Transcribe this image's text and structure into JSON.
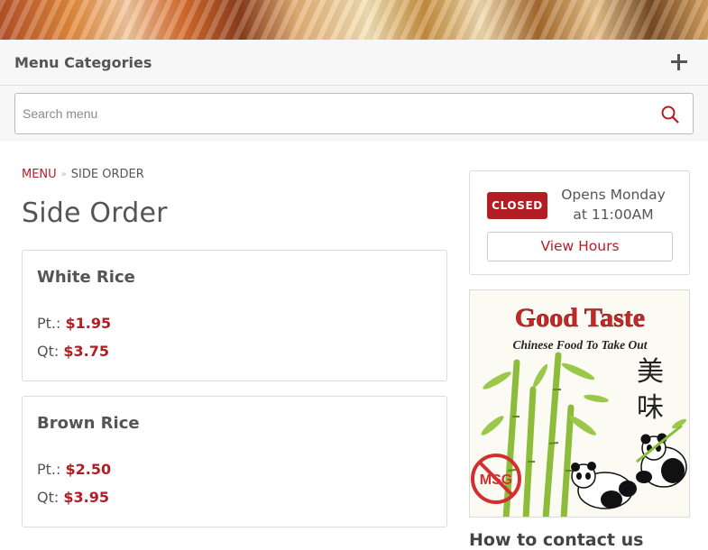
{
  "menu_categories": {
    "title": "Menu Categories",
    "toggle_icon": "plus-icon"
  },
  "search": {
    "placeholder": "Search menu",
    "value": "",
    "icon": "search-icon"
  },
  "breadcrumb": {
    "root": "MENU",
    "current": "SIDE ORDER"
  },
  "page": {
    "title": "Side Order"
  },
  "items": [
    {
      "name": "White Rice",
      "prices": [
        {
          "size": "Pt.:",
          "price": "$1.95"
        },
        {
          "size": "Qt:",
          "price": "$3.75"
        }
      ]
    },
    {
      "name": "Brown Rice",
      "prices": [
        {
          "size": "Pt.:",
          "price": "$2.50"
        },
        {
          "size": "Qt:",
          "price": "$3.95"
        }
      ]
    }
  ],
  "hours": {
    "status": "CLOSED",
    "opens_line1": "Opens Monday",
    "opens_line2": "at 11:00AM",
    "view_hours_label": "View Hours"
  },
  "logo": {
    "name": "Good Taste",
    "tagline": "Chinese Food To Take Out",
    "chinese": [
      "美",
      "味"
    ],
    "badge": "MSG"
  },
  "contact": {
    "heading": "How to contact us"
  },
  "colors": {
    "accent": "#b31e24",
    "text": "#555555",
    "border": "#dcdcdc",
    "bar_bg": "#f7f7f7"
  }
}
